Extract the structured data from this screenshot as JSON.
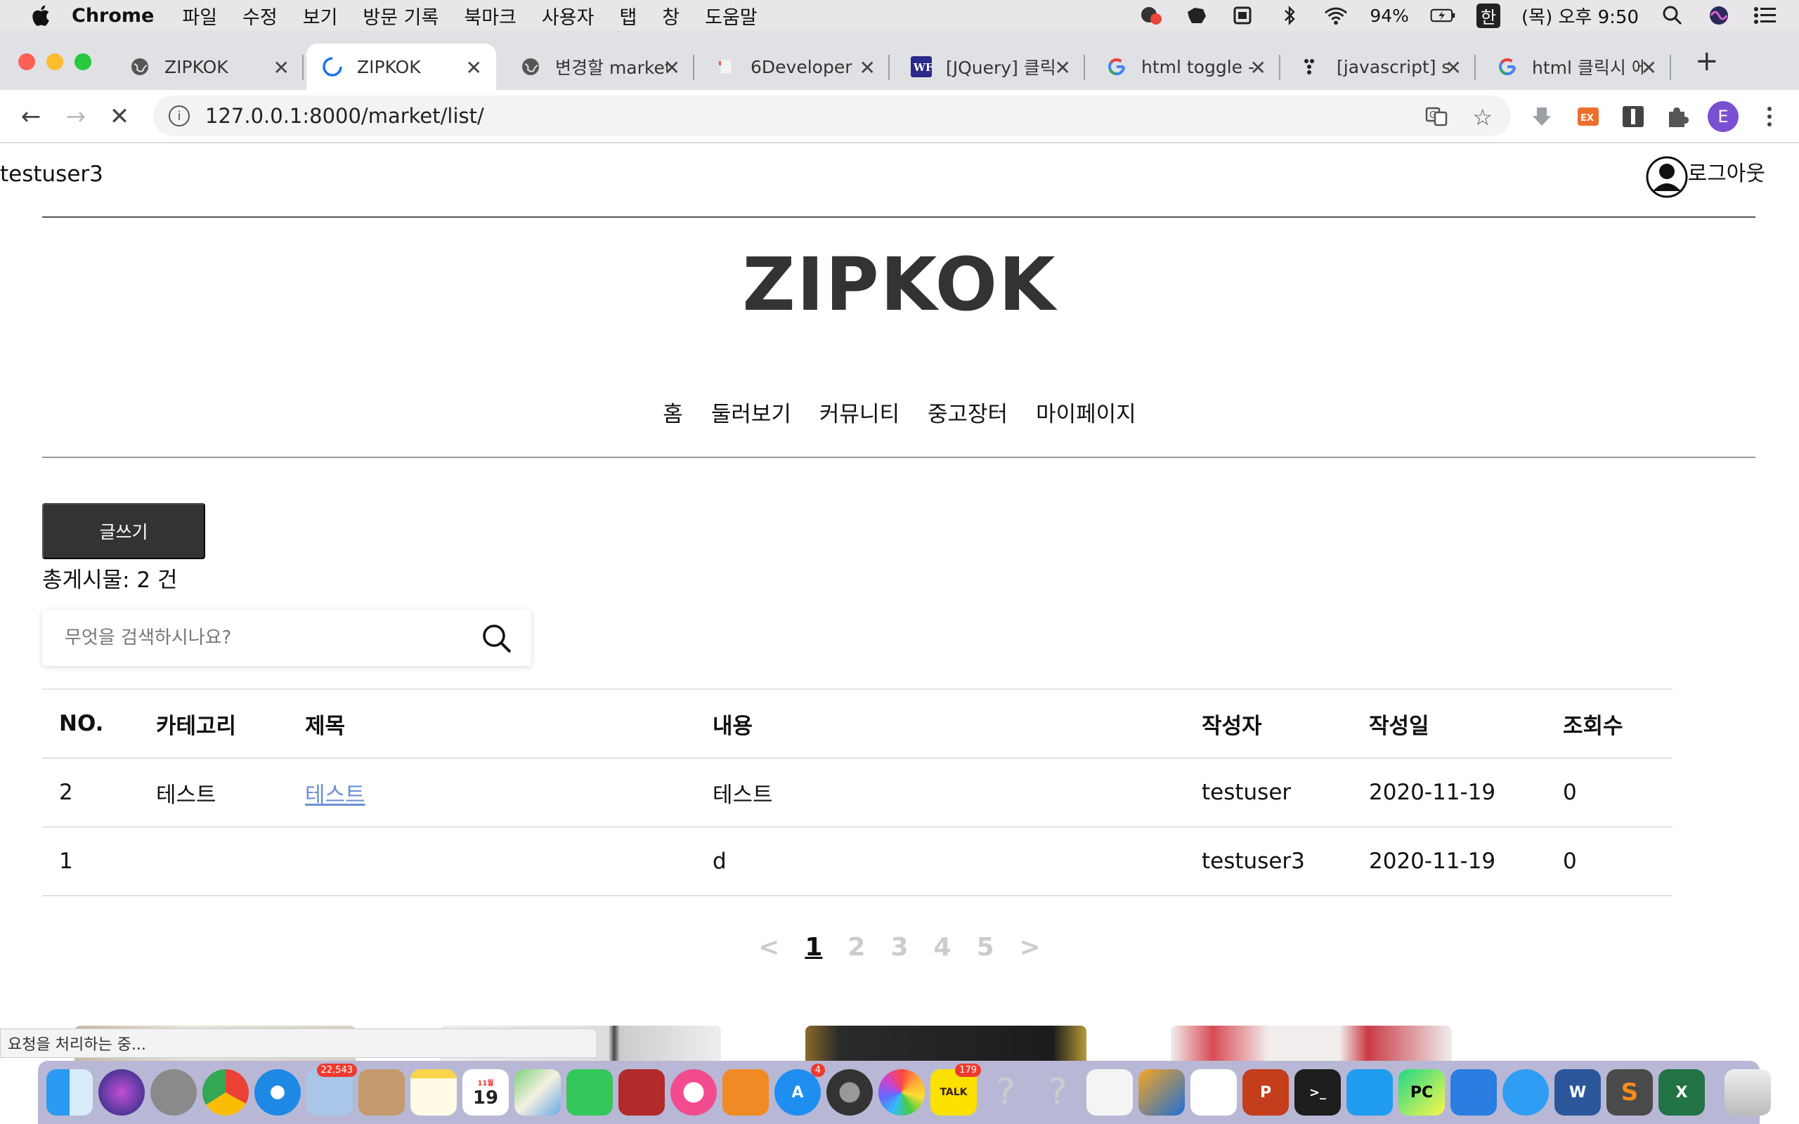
{
  "menubar": {
    "app": "Chrome",
    "items": [
      "파일",
      "수정",
      "보기",
      "방문 기록",
      "북마크",
      "사용자",
      "탭",
      "창",
      "도움말"
    ],
    "battery": "94%",
    "input_method": "한",
    "clock": "(목) 오후 9:50"
  },
  "tabs": [
    {
      "title": "ZIPKOK",
      "icon": "globe-icon"
    },
    {
      "title": "ZIPKOK",
      "icon": "loading-spinner-icon"
    },
    {
      "title": "변경할 market",
      "icon": "globe-icon"
    },
    {
      "title": "6Developer",
      "icon": "page-icon"
    },
    {
      "title": "[JQuery] 클릭",
      "icon": "wf-icon"
    },
    {
      "title": "html toggle -",
      "icon": "google-icon"
    },
    {
      "title": "[javascript] s",
      "icon": "dots-icon"
    },
    {
      "title": "html 클릭시 에",
      "icon": "google-icon"
    }
  ],
  "toolbar": {
    "url": "127.0.0.1:8000/market/list/"
  },
  "page": {
    "username": "testuser3",
    "logout": "로그아웃",
    "logo": "ZIPKOK",
    "nav": [
      "홈",
      "둘러보기",
      "커뮤니티",
      "중고장터",
      "마이페이지"
    ],
    "write_button": "글쓰기",
    "total": "총게시물: 2 건",
    "search_placeholder": "무엇을 검색하시나요?",
    "table": {
      "headers": [
        "NO.",
        "카테고리",
        "제목",
        "내용",
        "작성자",
        "작성일",
        "조회수"
      ],
      "rows": [
        {
          "no": "2",
          "category": "테스트",
          "title": "테스트",
          "content": "테스트",
          "author": "testuser",
          "date": "2020-11-19",
          "views": "0"
        },
        {
          "no": "1",
          "category": "",
          "title": "",
          "content": "d",
          "author": "testuser3",
          "date": "2020-11-19",
          "views": "0"
        }
      ]
    },
    "pager": {
      "prev": "<",
      "pages": [
        "1",
        "2",
        "3",
        "4",
        "5"
      ],
      "next": ">"
    },
    "status": "요청을 처리하는 중..."
  },
  "dock": {
    "badges": {
      "mail": "22,543",
      "calendar_day": "19",
      "calendar_month": "11월",
      "appstore": "4",
      "kakaotalk": "179"
    }
  },
  "colors": {
    "accent_dark": "#333333",
    "link": "#6b8fd6",
    "profile": "#7b4fd1"
  }
}
